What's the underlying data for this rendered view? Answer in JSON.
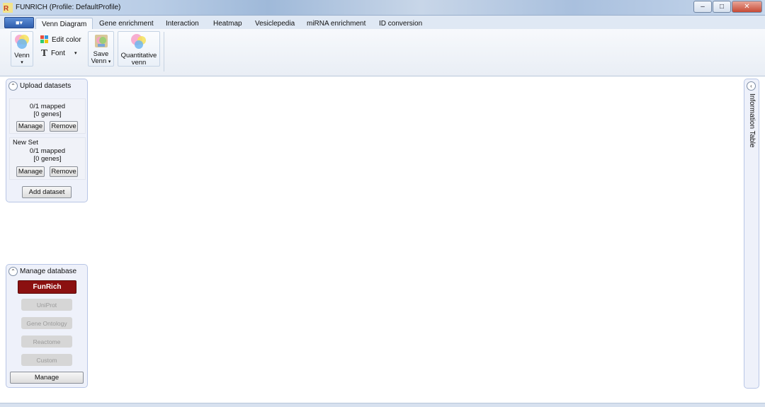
{
  "window": {
    "title": "FUNRICH (Profile:  DefaultProfile)",
    "minimize_glyph": "–",
    "maximize_glyph": "□",
    "close_glyph": "✕"
  },
  "ribbon": {
    "tabs": [
      {
        "label": "Venn Diagram",
        "active": true
      },
      {
        "label": "Gene enrichment"
      },
      {
        "label": "Interaction"
      },
      {
        "label": "Heatmap"
      },
      {
        "label": "Vesiclepedia"
      },
      {
        "label": "miRNA enrichment"
      },
      {
        "label": "ID conversion"
      }
    ],
    "venn_label": "Venn",
    "edit_color_label": "Edit color",
    "font_label": "Font",
    "save_venn_line1": "Save",
    "save_venn_line2": "Venn",
    "quantitative_line1": "Quantitative",
    "quantitative_line2": "venn"
  },
  "upload_panel": {
    "title": "Upload datasets",
    "sets": [
      {
        "name": "",
        "mapped": "0/1 mapped",
        "genes": "[0 genes]",
        "manage_label": "Manage",
        "remove_label": "Remove"
      },
      {
        "name": "New Set",
        "mapped": "0/1 mapped",
        "genes": "[0 genes]",
        "manage_label": "Manage",
        "remove_label": "Remove"
      }
    ],
    "add_dataset_label": "Add dataset"
  },
  "database_panel": {
    "title": "Manage database",
    "selected": "FunRich",
    "options": [
      "UniProt",
      "Gene Ontology",
      "Reactome",
      "Custom"
    ],
    "manage_label": "Manage"
  },
  "info_panel": {
    "title": "Information Table"
  },
  "colors": {
    "funrich_button": "#8b1010",
    "panel_border": "#b8c6e6",
    "panel_bg": "#eef1fa"
  }
}
